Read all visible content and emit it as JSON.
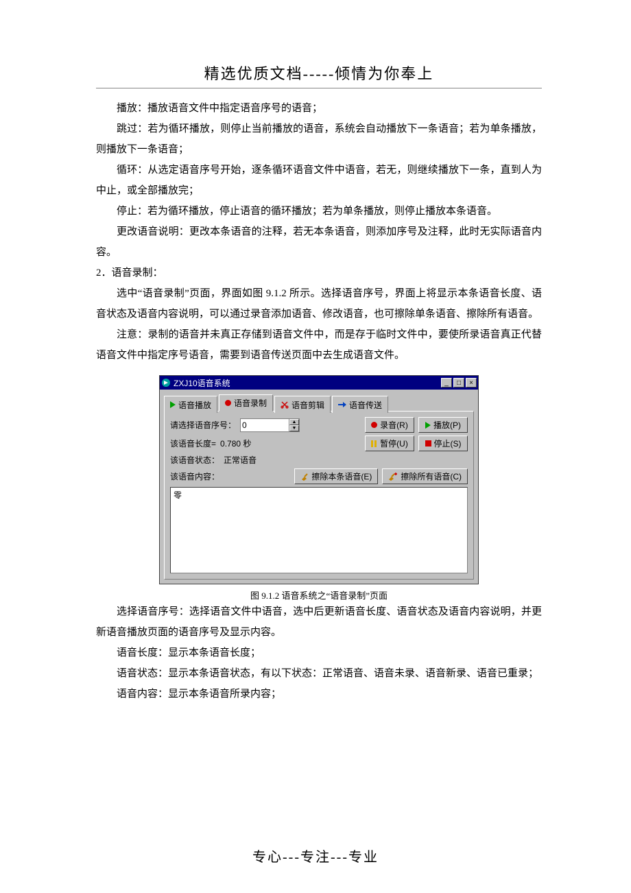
{
  "header": "精选优质文档-----倾情为你奉上",
  "body": {
    "p1": "播放：播放语音文件中指定语音序号的语音；",
    "p2": "跳过：若为循环播放，则停止当前播放的语音，系统会自动播放下一条语音；若为单条播放，则播放下一条语音；",
    "p3": "循环：从选定语音序号开始，逐条循环语音文件中语音，若无，则继续播放下一条，直到人为中止，或全部播放完；",
    "p4": "停止：若为循环播放，停止语音的循环播放；若为单条播放，则停止播放本条语音。",
    "p5": "更改语音说明：更改本条语音的注释，若无本条语音，则添加序号及注释，此时无实际语音内容。",
    "s2_title": "2．语音录制：",
    "p6": "选中“语音录制”页面，界面如图 9.1.2 所示。选择语音序号，界面上将显示本条语音长度、语音状态及语音内容说明，可以通过录音添加语音、修改语音，也可擦除单条语音、擦除所有语音。",
    "p7": "注意：录制的语音并未真正存储到语音文件中，而是存于临时文件中，要使所录语音真正代替语音文件中指定序号语音，需要到语音传送页面中去生成语音文件。",
    "p8": "选择语音序号：选择语音文件中语音，选中后更新语音长度、语音状态及语音内容说明，并更新语音播放页面的语音序号及显示内容。",
    "p9": "语音长度：显示本条语音长度；",
    "p10": "语音状态：显示本条语音状态，有以下状态：正常语音、语音未录、语音新录、语音已重录；",
    "p11": "语音内容：显示本条语音所录内容；"
  },
  "app": {
    "title": "ZXJ10语音系统",
    "tabs": {
      "play": "语音播放",
      "record": "语音录制",
      "cut": "语音剪辑",
      "send": "语音传送"
    },
    "labels": {
      "select_seq": "请选择语音序号：",
      "length_prefix": "该语音长度=",
      "length_value": "0.780 秒",
      "status_prefix": "该语音状态：",
      "status_value": "正常语音",
      "content_prefix": "该语音内容："
    },
    "inputs": {
      "seq_value": "0"
    },
    "buttons": {
      "record": "录音(R)",
      "play": "播放(P)",
      "pause": "暂停(U)",
      "stop": "停止(S)",
      "erase_one": "擦除本条语音(E)",
      "erase_all": "擦除所有语音(C)"
    },
    "textarea_value": "零"
  },
  "caption": "图 9.1.2 语音系统之“语音录制”页面",
  "footer": "专心---专注---专业"
}
